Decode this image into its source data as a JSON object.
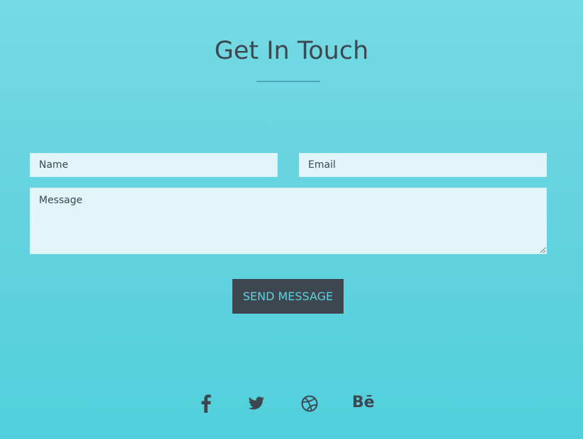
{
  "section": {
    "title": "Get In Touch"
  },
  "form": {
    "name_placeholder": "Name",
    "email_placeholder": "Email",
    "message_placeholder": "Message",
    "submit_label": "SEND MESSAGE"
  },
  "social": {
    "items": [
      {
        "icon": "facebook-icon"
      },
      {
        "icon": "twitter-icon"
      },
      {
        "icon": "dribbble-icon"
      },
      {
        "icon": "behance-icon",
        "label": "Bē"
      }
    ]
  },
  "colors": {
    "background_top": "#75dae3",
    "background_bottom": "#52cfdd",
    "text": "#3d4750",
    "field_bg": "#e2f6f9",
    "button_bg": "#3e4650",
    "button_text": "#5dd3e0"
  }
}
